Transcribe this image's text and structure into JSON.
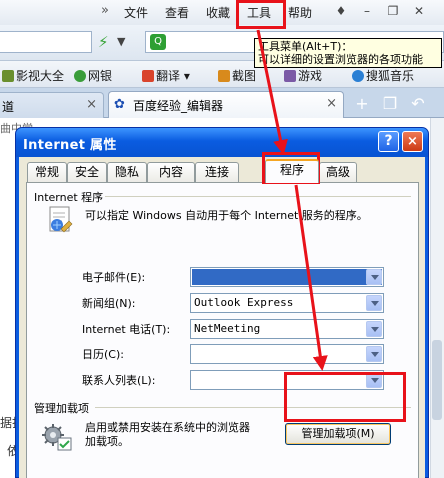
{
  "menubar": {
    "items": [
      "文件",
      "查看",
      "收藏",
      "工具",
      "帮助"
    ],
    "chevron": "»"
  },
  "tooltip": {
    "line1": "工具菜单(Alt+T)：",
    "line2": "可以详细的设置浏览器的各项功能"
  },
  "favorites": {
    "items": [
      "影视大全",
      "网银",
      "翻译",
      "截图",
      "游戏",
      "搜狐音乐"
    ]
  },
  "tabs_browser": {
    "tab1": "道",
    "tab2": "百度经验_编辑器",
    "close": "×"
  },
  "background_fragments": {
    "top": "曲中学",
    "left": "据打",
    "bottom": "依"
  },
  "dialog": {
    "title": "Internet 属性",
    "help": "?",
    "close": "×",
    "tabs": [
      "常规",
      "安全",
      "隐私",
      "内容",
      "连接",
      "程序",
      "高级"
    ],
    "programs_group": {
      "label": "Internet 程序",
      "description": "可以指定 Windows 自动用于每个 Internet 服务的程序。",
      "fields": [
        {
          "label": "电子邮件(E):",
          "value": ""
        },
        {
          "label": "新闻组(N):",
          "value": "Outlook Express"
        },
        {
          "label": "Internet 电话(T):",
          "value": "NetMeeting"
        },
        {
          "label": "日历(C):",
          "value": ""
        },
        {
          "label": "联系人列表(L):",
          "value": ""
        }
      ]
    },
    "addons_group": {
      "label": "管理加载项",
      "description_line1": "启用或禁用安装在系统中的浏览器",
      "description_line2": "加载项。",
      "button": "管理加载项(M)"
    }
  },
  "colors": {
    "annotation_red": "#e8121a",
    "xp_blue": "#0a5ce0",
    "selection": "#316ac5"
  }
}
